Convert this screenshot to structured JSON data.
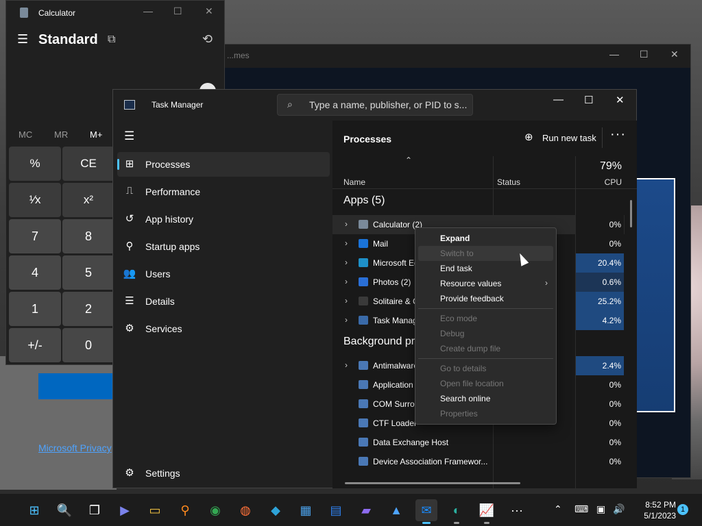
{
  "background": {
    "back_window_title": "...mes",
    "privacy_link": "Microsoft Privacy"
  },
  "calculator": {
    "title": "Calculator",
    "mode": "Standard",
    "memory": [
      "MC",
      "MR",
      "M+"
    ],
    "keys": [
      {
        "label": "%",
        "type": "op"
      },
      {
        "label": "CE",
        "type": "op"
      },
      {
        "label": "¹⁄x",
        "type": "op"
      },
      {
        "label": "x²",
        "type": "op"
      },
      {
        "label": "7",
        "type": "num"
      },
      {
        "label": "8",
        "type": "num"
      },
      {
        "label": "4",
        "type": "num"
      },
      {
        "label": "5",
        "type": "num"
      },
      {
        "label": "1",
        "type": "num"
      },
      {
        "label": "2",
        "type": "num"
      },
      {
        "label": "+/-",
        "type": "num"
      },
      {
        "label": "0",
        "type": "num"
      }
    ]
  },
  "taskmanager": {
    "title": "Task Manager",
    "search_placeholder": "Type a name, publisher, or PID to s...",
    "nav": [
      {
        "label": "Processes",
        "icon": "processes-icon",
        "glyph": "⊞",
        "active": true
      },
      {
        "label": "Performance",
        "icon": "performance-icon",
        "glyph": "⎍",
        "active": false
      },
      {
        "label": "App history",
        "icon": "app-history-icon",
        "glyph": "↺",
        "active": false
      },
      {
        "label": "Startup apps",
        "icon": "startup-apps-icon",
        "glyph": "⚲",
        "active": false
      },
      {
        "label": "Users",
        "icon": "users-icon",
        "glyph": "👥",
        "active": false
      },
      {
        "label": "Details",
        "icon": "details-icon",
        "glyph": "☰",
        "active": false
      },
      {
        "label": "Services",
        "icon": "services-icon",
        "glyph": "⚙",
        "active": false
      }
    ],
    "settings_label": "Settings",
    "pane_title": "Processes",
    "run_new_task": "Run new task",
    "columns": {
      "name": "Name",
      "status": "Status",
      "cpu_total": "79%",
      "cpu": "CPU"
    },
    "groups": [
      {
        "label": "Apps (5)",
        "rows": [
          {
            "name": "Calculator (2)",
            "cpu": "0%",
            "cpu_level": 0,
            "icon_color": "#7a8a9a",
            "expandable": true,
            "highlight": true
          },
          {
            "name": "Mail",
            "cpu": "0%",
            "cpu_level": 0,
            "icon_color": "#1a73d9",
            "expandable": true,
            "highlight": false
          },
          {
            "name": "Microsoft Edge",
            "cpu": "20.4%",
            "cpu_level": 2,
            "icon_color": "#1e90c8",
            "expandable": true,
            "highlight": false
          },
          {
            "name": "Photos (2)",
            "cpu": "0.6%",
            "cpu_level": 1,
            "icon_color": "#2a6fd6",
            "expandable": true,
            "highlight": false
          },
          {
            "name": "Solitaire & Casual Games",
            "cpu": "25.2%",
            "cpu_level": 2,
            "icon_color": "#3a3a3a",
            "expandable": true,
            "highlight": false
          },
          {
            "name": "Task Manager",
            "cpu": "4.2%",
            "cpu_level": 2,
            "icon_color": "#3a6aa8",
            "expandable": true,
            "highlight": false
          }
        ]
      },
      {
        "label": "Background processes",
        "rows": [
          {
            "name": "Antimalware Service Executable",
            "cpu": "2.4%",
            "cpu_level": 2,
            "icon_color": "#4a78b5",
            "expandable": true,
            "highlight": false
          },
          {
            "name": "Application Frame Host",
            "cpu": "0%",
            "cpu_level": 0,
            "icon_color": "#4a78b5",
            "expandable": false,
            "highlight": false
          },
          {
            "name": "COM Surrogate",
            "cpu": "0%",
            "cpu_level": 0,
            "icon_color": "#4a78b5",
            "expandable": false,
            "highlight": false
          },
          {
            "name": "CTF Loader",
            "cpu": "0%",
            "cpu_level": 0,
            "icon_color": "#4a78b5",
            "expandable": false,
            "highlight": false
          },
          {
            "name": "Data Exchange Host",
            "cpu": "0%",
            "cpu_level": 0,
            "icon_color": "#4a78b5",
            "expandable": false,
            "highlight": false
          },
          {
            "name": "Device Association Framewor...",
            "cpu": "0%",
            "cpu_level": 0,
            "icon_color": "#4a78b5",
            "expandable": false,
            "highlight": false
          }
        ]
      }
    ]
  },
  "context_menu": {
    "items": [
      {
        "label": "Expand",
        "enabled": true,
        "bold": true,
        "submenu": false,
        "hover": false
      },
      {
        "label": "Switch to",
        "enabled": false,
        "bold": false,
        "submenu": false,
        "hover": true
      },
      {
        "label": "End task",
        "enabled": true,
        "bold": false,
        "submenu": false,
        "hover": false
      },
      {
        "label": "Resource values",
        "enabled": true,
        "bold": false,
        "submenu": true,
        "hover": false
      },
      {
        "label": "Provide feedback",
        "enabled": true,
        "bold": false,
        "submenu": false,
        "hover": false
      },
      {
        "sep": true
      },
      {
        "label": "Eco mode",
        "enabled": false,
        "bold": false,
        "submenu": false,
        "hover": false
      },
      {
        "label": "Debug",
        "enabled": false,
        "bold": false,
        "submenu": false,
        "hover": false
      },
      {
        "label": "Create dump file",
        "enabled": false,
        "bold": false,
        "submenu": false,
        "hover": false
      },
      {
        "sep": true
      },
      {
        "label": "Go to details",
        "enabled": false,
        "bold": false,
        "submenu": false,
        "hover": false
      },
      {
        "label": "Open file location",
        "enabled": false,
        "bold": false,
        "submenu": false,
        "hover": false
      },
      {
        "label": "Search online",
        "enabled": true,
        "bold": false,
        "submenu": false,
        "hover": false
      },
      {
        "label": "Properties",
        "enabled": false,
        "bold": false,
        "submenu": false,
        "hover": false
      }
    ]
  },
  "taskbar": {
    "apps": [
      {
        "name": "start-button",
        "glyph": "⊞",
        "color": "#4cc2ff",
        "active": false,
        "running": false
      },
      {
        "name": "search-button",
        "glyph": "🔍",
        "color": "#ffffff",
        "active": false,
        "running": false
      },
      {
        "name": "task-view-button",
        "glyph": "❐",
        "color": "#ffffff",
        "active": false,
        "running": false
      },
      {
        "name": "teams-app",
        "glyph": "▶",
        "color": "#7b83eb",
        "active": false,
        "running": false
      },
      {
        "name": "file-explorer-app",
        "glyph": "▭",
        "color": "#f5c542",
        "active": false,
        "running": false
      },
      {
        "name": "search-tool-app",
        "glyph": "⚲",
        "color": "#ff8a1e",
        "active": false,
        "running": false
      },
      {
        "name": "chrome-app",
        "glyph": "◉",
        "color": "#34a853",
        "active": false,
        "running": false
      },
      {
        "name": "firefox-app",
        "glyph": "◍",
        "color": "#ff7139",
        "active": false,
        "running": false
      },
      {
        "name": "remote-app",
        "glyph": "◆",
        "color": "#2ea3d8",
        "active": false,
        "running": false
      },
      {
        "name": "store-app",
        "glyph": "▦",
        "color": "#4a9fe8",
        "active": false,
        "running": false
      },
      {
        "name": "calendar-app",
        "glyph": "▤",
        "color": "#2f80ed",
        "active": false,
        "running": false
      },
      {
        "name": "clipchamp-app",
        "glyph": "▰",
        "color": "#8e6cf0",
        "active": false,
        "running": false
      },
      {
        "name": "photos-app",
        "glyph": "▲",
        "color": "#4da3ff",
        "active": false,
        "running": false
      },
      {
        "name": "mail-app",
        "glyph": "✉",
        "color": "#1a8cff",
        "active": true,
        "running": true
      },
      {
        "name": "edge-app",
        "glyph": "◐",
        "color": "#2bb0a0",
        "active": false,
        "running": true
      },
      {
        "name": "task-manager-app",
        "glyph": "📈",
        "color": "#9ab8d8",
        "active": false,
        "running": true
      },
      {
        "name": "more-apps-button",
        "glyph": "···",
        "color": "#ffffff",
        "active": false,
        "running": false
      }
    ],
    "time": "8:52 PM",
    "date": "5/1/2023",
    "notification_count": "1"
  }
}
